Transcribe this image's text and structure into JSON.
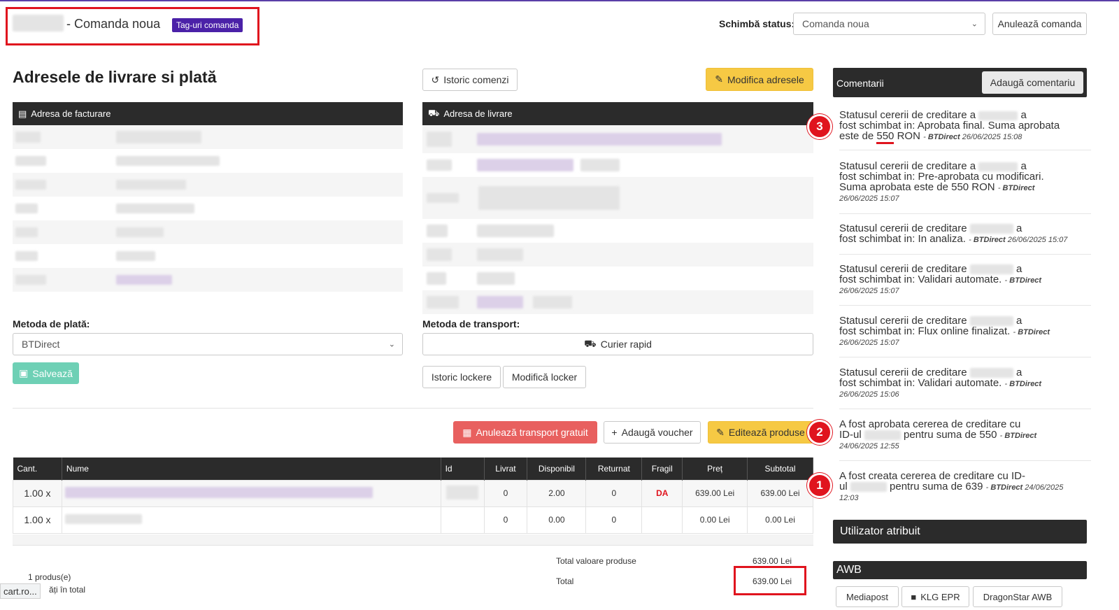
{
  "header": {
    "order_title": "- Comanda noua",
    "tags_badge": "Tag-uri comanda",
    "status_label": "Schimbă status:",
    "status_value": "Comanda noua",
    "cancel_button": "Anulează comanda"
  },
  "addresses": {
    "title": "Adresele de livrare si plată",
    "history_button": "Istoric comenzi",
    "modify_button": "Modifica adresele",
    "billing_header": "Adresa de facturare",
    "shipping_header": "Adresa de livrare"
  },
  "payment": {
    "label": "Metoda de plată:",
    "value": "BTDirect",
    "save_button": "Salvează"
  },
  "transport": {
    "label": "Metoda de transport:",
    "value": "Curier rapid",
    "locker_history_button": "Istoric lockere",
    "locker_modify_button": "Modifică locker"
  },
  "actions": {
    "cancel_free_transport": "Anulează transport gratuit",
    "add_voucher": "Adaugă voucher",
    "edit_products": "Editează produse"
  },
  "products": {
    "columns": [
      "Cant.",
      "Nume",
      "Id",
      "Livrat",
      "Disponibil",
      "Returnat",
      "Fragil",
      "Preț",
      "Subtotal"
    ],
    "rows": [
      {
        "qty": "1.00 x",
        "delivered": "0",
        "available": "2.00",
        "returned": "0",
        "fragile": "DA",
        "price": "639.00 Lei",
        "subtotal": "639.00 Lei"
      },
      {
        "qty": "1.00 x",
        "delivered": "0",
        "available": "0.00",
        "returned": "0",
        "fragile": "",
        "price": "0.00 Lei",
        "subtotal": "0.00 Lei"
      }
    ],
    "total_products_label": "Total valoare produse",
    "total_products_value": "639.00 Lei",
    "total_label": "Total",
    "total_value": "639.00 Lei",
    "count_text": "1 produs(e)",
    "count_text2": "ăți în total",
    "url_tooltip": "cart.ro..."
  },
  "comments": {
    "title": "Comentarii",
    "add_button": "Adaugă comentariu",
    "items": [
      {
        "l1a": "Statusul cererii de creditare a",
        "l1b": "a",
        "l2": "fost schimbat in: Aprobata final. Suma aprobata",
        "l3a": "este de ",
        "l3amt": "550",
        "l3b": " RON",
        "author": "BTDirect",
        "date": "26/06/2025 15:08"
      },
      {
        "l1a": "Statusul cererii de creditare a",
        "l1b": "a",
        "l2": "fost schimbat in: Pre-aprobata cu modificari.",
        "l3": "Suma aprobata este de 550 RON",
        "author": "BTDirect",
        "date": "26/06/2025 15:07"
      },
      {
        "l1a": "Statusul cererii de creditare",
        "l1b": "a",
        "l2": "fost schimbat in: In analiza.",
        "author": "BTDirect",
        "date": "26/06/2025 15:07"
      },
      {
        "l1a": "Statusul cererii de creditare",
        "l1b": "a",
        "l2": "fost schimbat in: Validari automate.",
        "author": "BTDirect",
        "date": "26/06/2025 15:07"
      },
      {
        "l1a": "Statusul cererii de creditare",
        "l1b": "a",
        "l2": "fost schimbat in: Flux online finalizat.",
        "author": "BTDirect",
        "date": "26/06/2025 15:07"
      },
      {
        "l1a": "Statusul cererii de creditare",
        "l1b": "a",
        "l2": "fost schimbat in: Validari automate.",
        "author": "BTDirect",
        "date": "26/06/2025 15:06"
      },
      {
        "l1a": "A fost aprobata cererea de creditare cu",
        "l2a": "ID-ul",
        "l2b": "pentru suma de 550",
        "author": "BTDirect",
        "date": "24/06/2025 12:55"
      },
      {
        "l1a": "A fost creata cererea de creditare cu ID-",
        "l2a": "ul",
        "l2b": "pentru suma de 639",
        "author": "BTDirect",
        "date": "24/06/2025",
        "date2": "12:03"
      }
    ]
  },
  "annotations": [
    "3",
    "2",
    "1"
  ],
  "assigned_user": {
    "title": "Utilizator atribuit"
  },
  "awb": {
    "title": "AWB",
    "buttons": [
      "Mediapost",
      "KLG EPR",
      "DragonStar AWB"
    ]
  }
}
